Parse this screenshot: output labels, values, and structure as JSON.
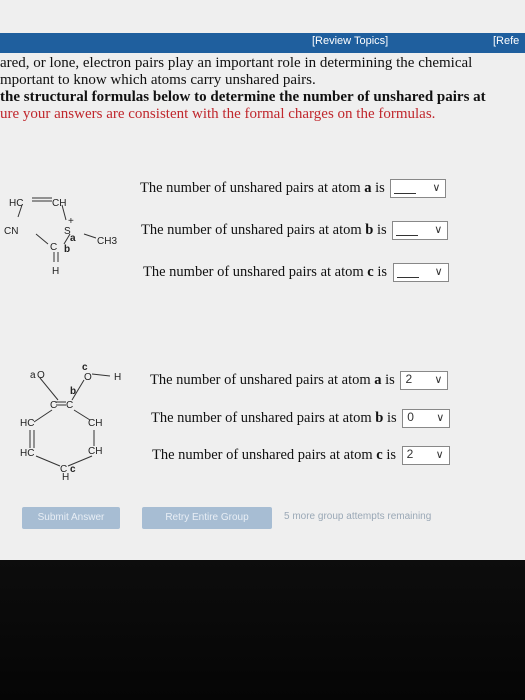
{
  "header": {
    "review_topics": "[Review Topics]",
    "references": "[Refe"
  },
  "intro": {
    "line1": "ared, or lone, electron pairs play an important role in determining the chemical",
    "line2": "mportant to know which atoms carry unshared pairs.",
    "line3": "the structural formulas below to determine the number of unshared pairs at",
    "line4": "ure your answers are consistent with the formal charges on the formulas."
  },
  "molecule1": {
    "atoms": [
      "HC",
      "CH",
      "CN",
      "S",
      "+",
      "a",
      "CH3",
      "C",
      "b",
      "H"
    ]
  },
  "molecule2": {
    "atoms": [
      "a",
      "O",
      "c",
      "O",
      "H",
      "b",
      "C",
      "C",
      "HC",
      "CH",
      "HC",
      "CH",
      "C",
      "c",
      "H"
    ]
  },
  "questions1": [
    {
      "prefix": "The number of unshared pairs at atom ",
      "atom": "a",
      "suffix": " is",
      "value": ""
    },
    {
      "prefix": "The number of unshared pairs at atom ",
      "atom": "b",
      "suffix": " is",
      "value": ""
    },
    {
      "prefix": "The number of unshared pairs at atom ",
      "atom": "c",
      "suffix": " is",
      "value": ""
    }
  ],
  "questions2": [
    {
      "prefix": "The number of unshared pairs at atom ",
      "atom": "a",
      "suffix": " is",
      "value": "2"
    },
    {
      "prefix": "The number of unshared pairs at atom ",
      "atom": "b",
      "suffix": " is",
      "value": "0"
    },
    {
      "prefix": "The number of unshared pairs at atom ",
      "atom": "c",
      "suffix": " is",
      "value": "2"
    }
  ],
  "actions": {
    "submit": "Submit Answer",
    "retry": "Retry Entire Group",
    "attempts": "5 more group attempts remaining"
  },
  "colors": {
    "header_bg": "#1f5f9e",
    "button_disabled": "#a7bdd3",
    "intro_red": "#c0272d"
  }
}
